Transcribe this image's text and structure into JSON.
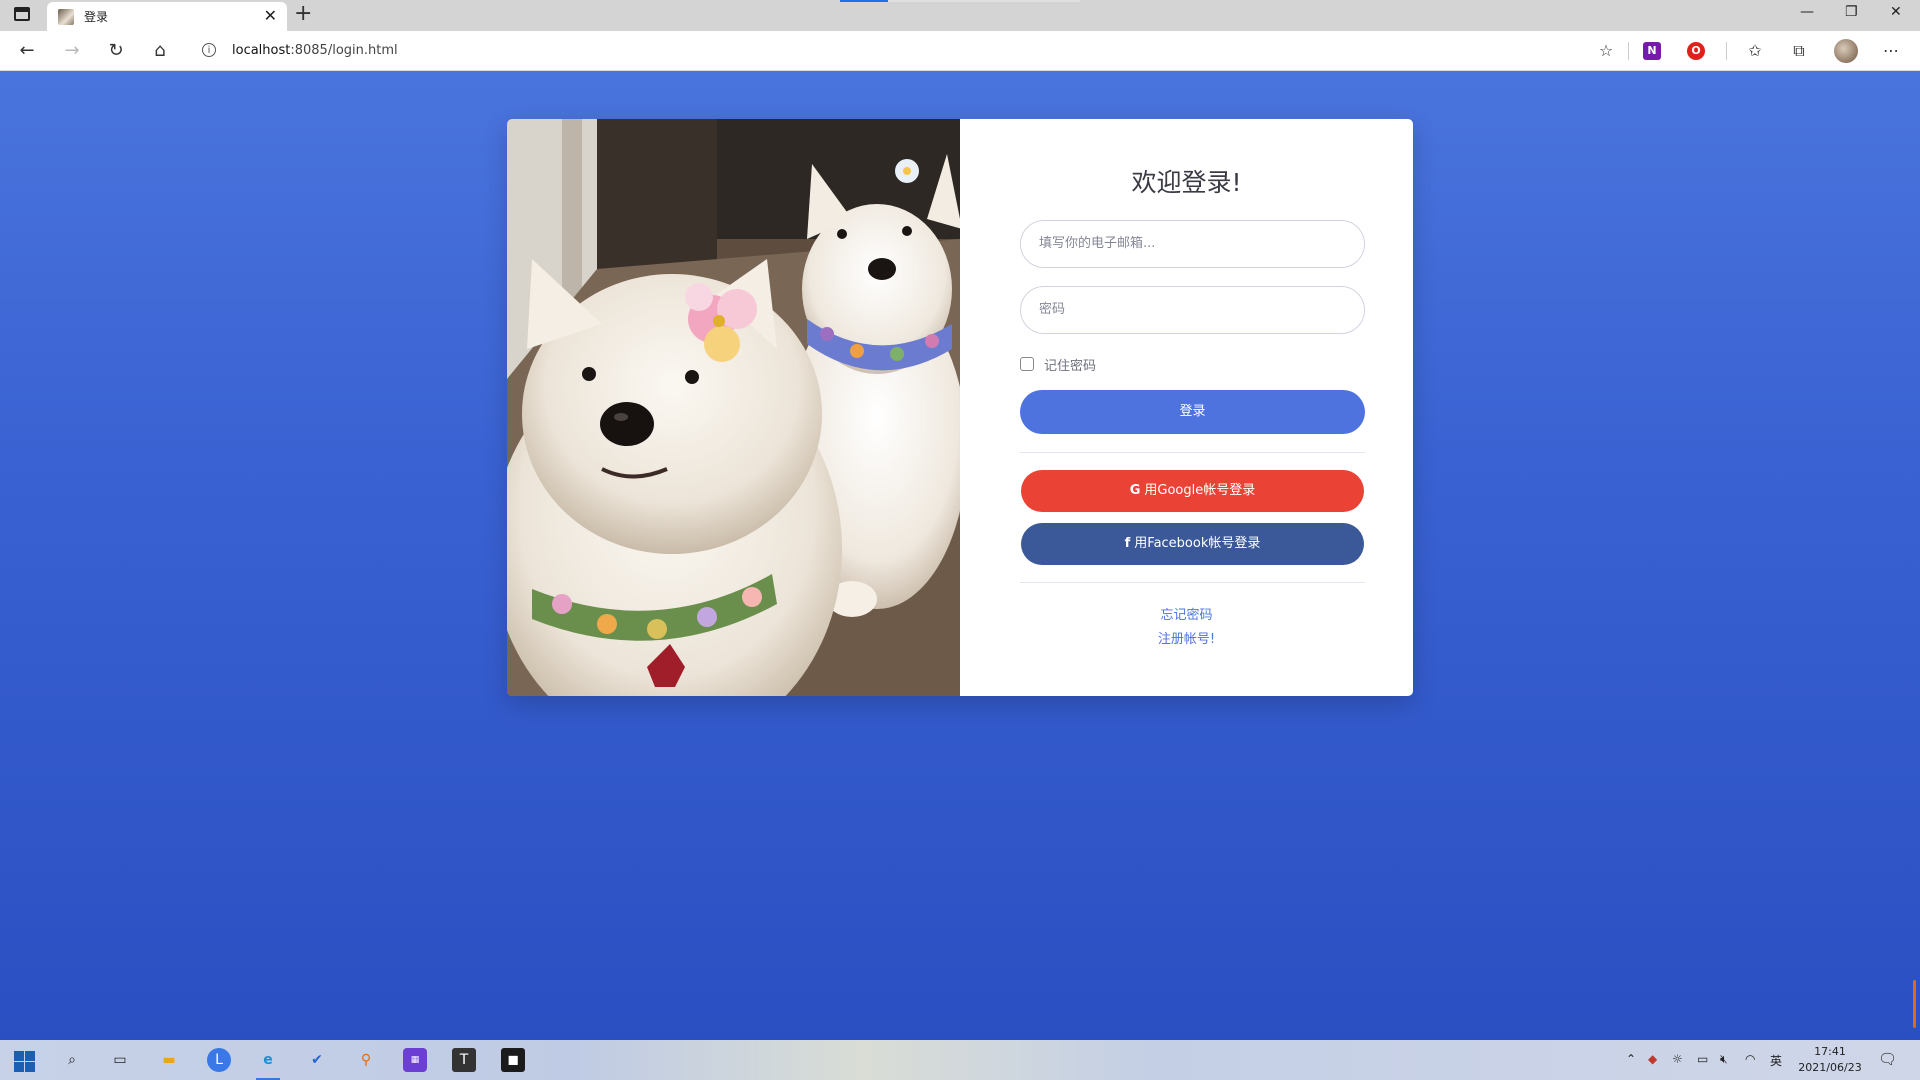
{
  "browser": {
    "tab": {
      "title": "登录",
      "close": "✕"
    },
    "new_tab": "+",
    "window_controls": {
      "minimize": "—",
      "restore": "❐",
      "close": "✕"
    },
    "address": {
      "host": "localhost",
      "path": ":8085/login.html"
    },
    "icons": [
      "sidebar-icon",
      "back-icon",
      "forward-icon",
      "refresh-icon",
      "home-icon",
      "info-icon",
      "favorite-add-icon",
      "onenote-icon",
      "opera-icon",
      "favorites-icon",
      "collections-icon",
      "profile-avatar",
      "more-icon"
    ]
  },
  "login": {
    "title": "欢迎登录!",
    "email_placeholder": "填写你的电子邮箱...",
    "password_placeholder": "密码",
    "remember_label": "记住密码",
    "login_button": "登录",
    "google_button": "用Google帐号登录",
    "google_icon": "G",
    "facebook_button": "用Facebook帐号登录",
    "facebook_icon": "f",
    "forgot_link": "忘记密码",
    "register_link": "注册帐号!"
  },
  "colors": {
    "background": "#4a74dd",
    "primary": "#4e73df",
    "google": "#ea4335",
    "facebook": "#3b5998"
  },
  "taskbar": {
    "apps": [
      "windows-start-icon",
      "search-icon",
      "task-view-icon",
      "file-explorer-icon",
      "l-app-icon",
      "edge-icon",
      "todo-icon",
      "search-tool-icon",
      "qq-icon",
      "typora-icon",
      "intellij-icon"
    ],
    "tray": {
      "language": "英"
    },
    "clock": {
      "time": "17:41",
      "date": "2021/06/23"
    }
  }
}
